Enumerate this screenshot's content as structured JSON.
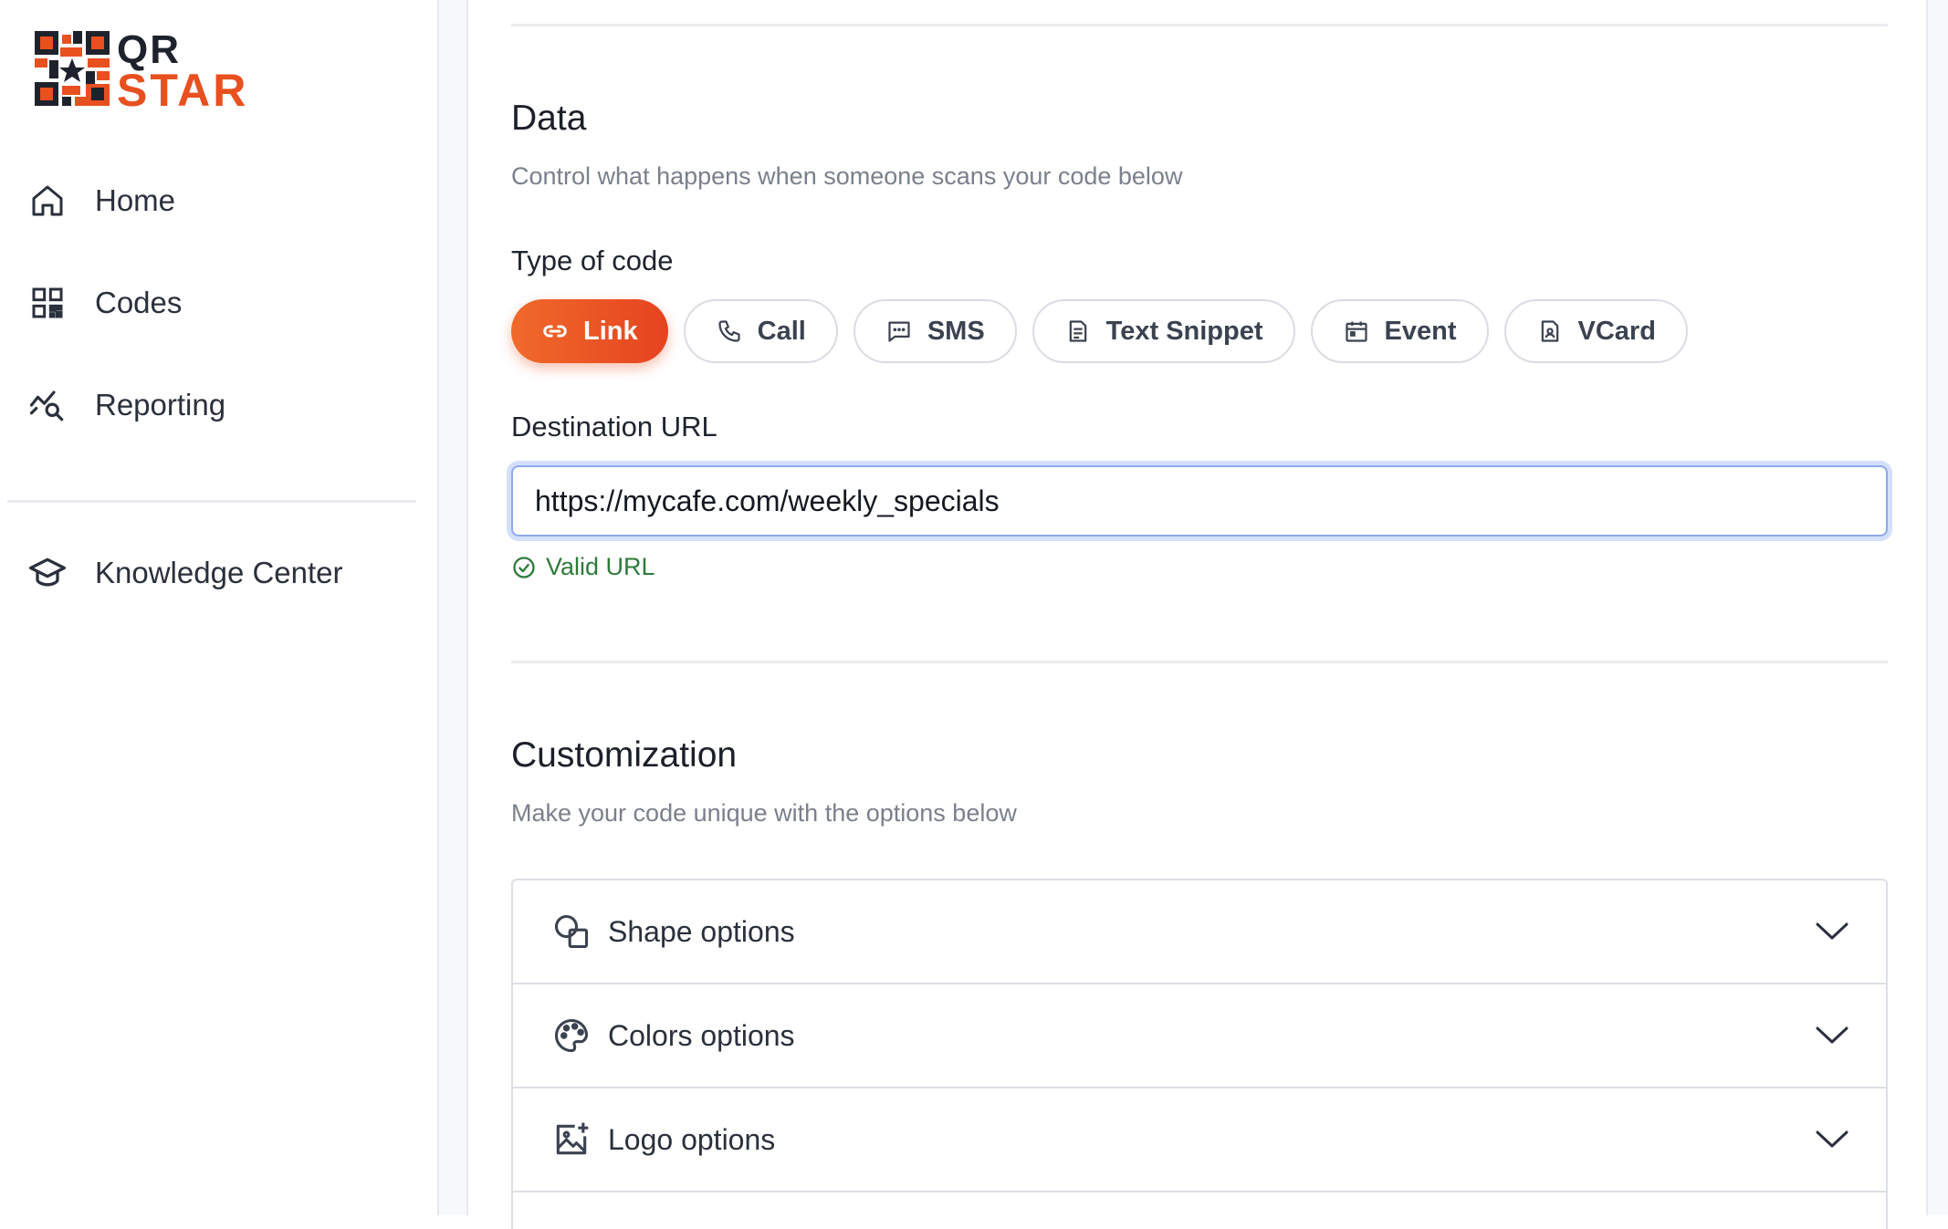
{
  "brand": {
    "logo_text_top": "QR",
    "logo_text_bottom": "STAR",
    "accent": "#e8501f"
  },
  "sidebar": {
    "items": [
      {
        "label": "Home",
        "icon": "home-icon"
      },
      {
        "label": "Codes",
        "icon": "qr-grid-icon"
      },
      {
        "label": "Reporting",
        "icon": "chart-search-icon"
      }
    ],
    "secondary": [
      {
        "label": "Knowledge Center",
        "icon": "graduation-cap-icon"
      }
    ]
  },
  "data_section": {
    "title": "Data",
    "subtitle": "Control what happens when someone scans your code below",
    "type_label": "Type of code",
    "types": [
      {
        "label": "Link",
        "icon": "link-icon",
        "active": true
      },
      {
        "label": "Call",
        "icon": "phone-icon",
        "active": false
      },
      {
        "label": "SMS",
        "icon": "message-icon",
        "active": false
      },
      {
        "label": "Text Snippet",
        "icon": "document-icon",
        "active": false
      },
      {
        "label": "Event",
        "icon": "calendar-icon",
        "active": false
      },
      {
        "label": "VCard",
        "icon": "contact-card-icon",
        "active": false
      }
    ],
    "destination_label": "Destination URL",
    "destination_value": "https://mycafe.com/weekly_specials",
    "validation": "Valid URL",
    "validation_color": "#2f7a3b"
  },
  "customization": {
    "title": "Customization",
    "subtitle": "Make your code unique with the options below",
    "options": [
      {
        "label": "Shape options",
        "icon": "shapes-icon"
      },
      {
        "label": "Colors options",
        "icon": "palette-icon"
      },
      {
        "label": "Logo options",
        "icon": "image-add-icon"
      }
    ]
  }
}
